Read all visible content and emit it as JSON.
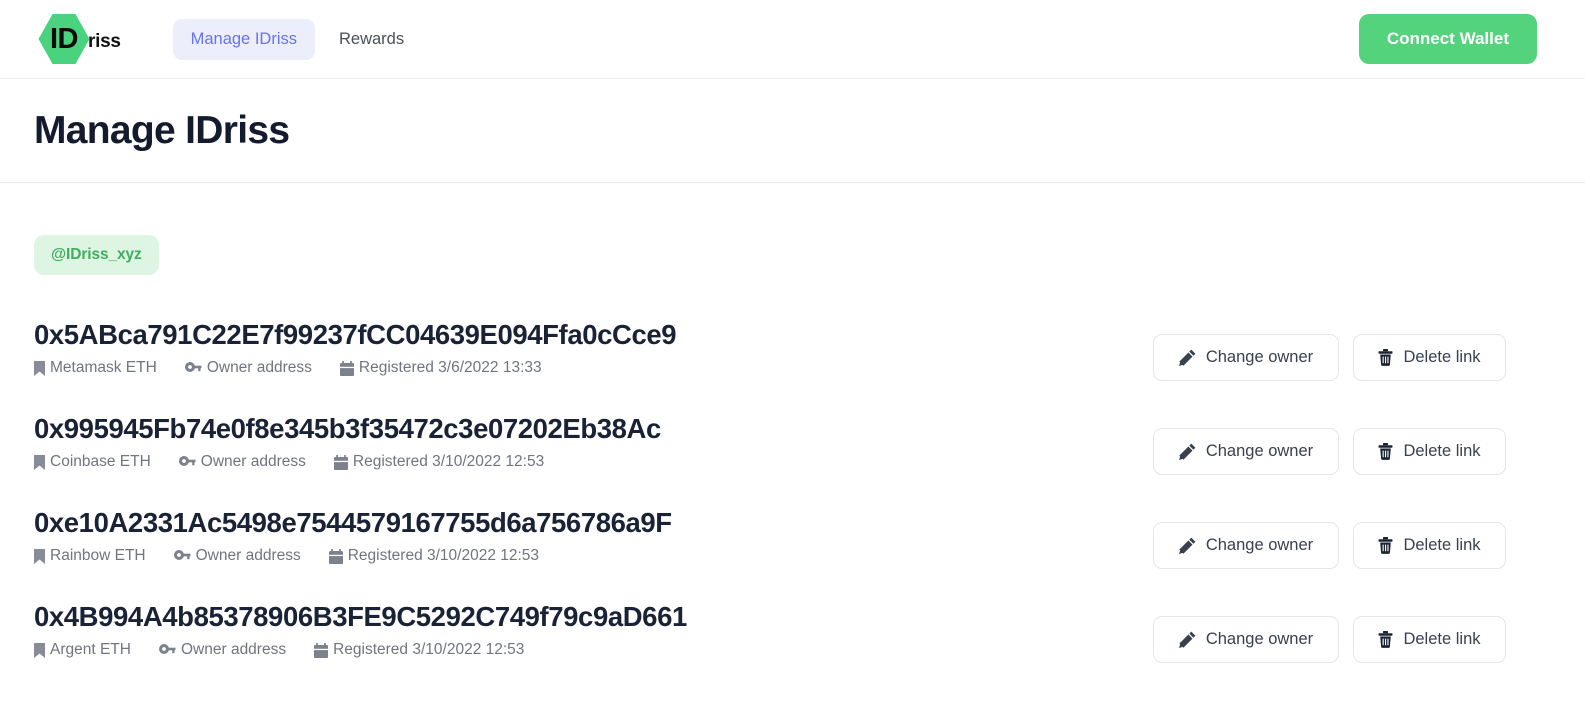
{
  "header": {
    "logo": {
      "mark_text": "ID",
      "rest_text": "riss",
      "brand_color": "#4ad27f"
    },
    "tabs": [
      {
        "label": "Manage IDriss",
        "active": true
      },
      {
        "label": "Rewards",
        "active": false
      }
    ],
    "connect_wallet_label": "Connect Wallet",
    "connect_wallet_color": "#54d37d"
  },
  "page": {
    "title": "Manage IDriss",
    "handle": "@IDriss_xyz",
    "handle_bg": "#ddf5e2",
    "handle_color": "#3fae5f"
  },
  "actions": {
    "change_owner_label": "Change owner",
    "delete_link_label": "Delete link"
  },
  "rows": [
    {
      "address": "0x5ABca791C22E7f99237fCC04639E094Ffa0cCce9",
      "wallet": "Metamask ETH",
      "role": "Owner address",
      "registered": "Registered 3/6/2022 13:33"
    },
    {
      "address": "0x995945Fb74e0f8e345b3f35472c3e07202Eb38Ac",
      "wallet": "Coinbase ETH",
      "role": "Owner address",
      "registered": "Registered 3/10/2022 12:53"
    },
    {
      "address": "0xe10A2331Ac5498e7544579167755d6a756786a9F",
      "wallet": "Rainbow ETH",
      "role": "Owner address",
      "registered": "Registered 3/10/2022 12:53"
    },
    {
      "address": "0x4B994A4b85378906B3FE9C5292C749f79c9aD661",
      "wallet": "Argent ETH",
      "role": "Owner address",
      "registered": "Registered 3/10/2022 12:53"
    }
  ]
}
